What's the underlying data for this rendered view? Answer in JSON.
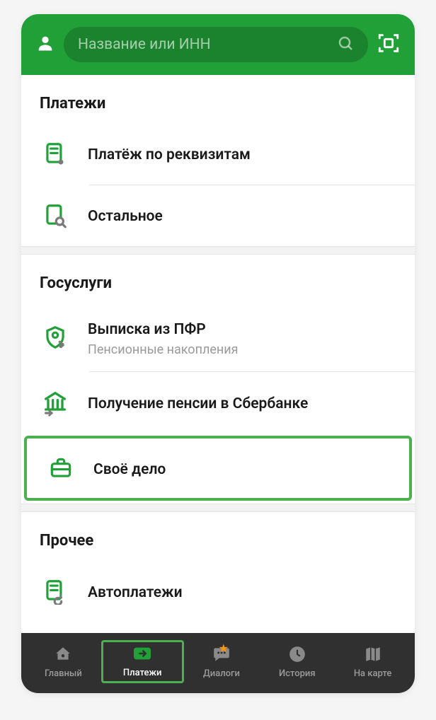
{
  "header": {
    "search_placeholder": "Название или ИНН"
  },
  "sections": {
    "payments": {
      "title": "Платежи",
      "items": [
        {
          "title": "Платёж по реквизитам"
        },
        {
          "title": "Остальное"
        }
      ]
    },
    "gosuslugi": {
      "title": "Госуслуги",
      "items": [
        {
          "title": "Выписка из ПФР",
          "subtitle": "Пенсионные накопления"
        },
        {
          "title": "Получение пенсии в Сбербанке"
        },
        {
          "title": "Своё дело"
        }
      ]
    },
    "other": {
      "title": "Прочее",
      "items": [
        {
          "title": "Автоплатежи"
        }
      ]
    }
  },
  "nav": {
    "items": [
      {
        "label": "Главный"
      },
      {
        "label": "Платежи"
      },
      {
        "label": "Диалоги"
      },
      {
        "label": "История"
      },
      {
        "label": "На карте"
      }
    ]
  }
}
